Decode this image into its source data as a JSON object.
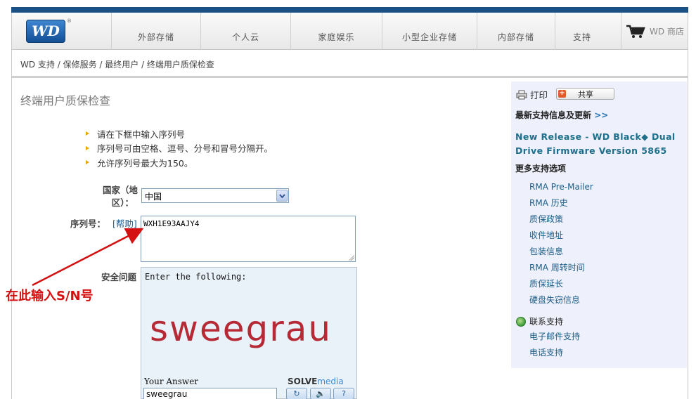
{
  "header": {
    "logo_text": "WD",
    "logo_mark": "®",
    "nav": [
      "外部存储",
      "个人云",
      "家庭娱乐",
      "小型企业存储",
      "内部存储",
      "支持"
    ],
    "shop_label": "WD 商店",
    "shop_icon": "cart-icon"
  },
  "breadcrumb": "WD 支持 / 保修服务 / 最终用户 / 终端用户质保检查",
  "main": {
    "title": "终端用户质保检查",
    "bullets": [
      "请在下框中输入序列号",
      "序列号可由空格、逗号、分号和冒号分隔开。",
      "允许序列号最大为150。"
    ],
    "country_label_line1": "国家（地",
    "country_label_line2": "区）：",
    "country_value": "中国",
    "serial_label": "序列号：",
    "help_link": "[帮助]",
    "serial_value": "WXH1E93AAJY4",
    "security_label": "安全问题",
    "captcha_prompt": "Enter the following:",
    "captcha_word": "sweegrau",
    "answer_label": "Your Answer",
    "answer_value": "sweegrau",
    "solve_brand_a": "SOLVE",
    "solve_brand_b": "media",
    "btn_refresh": "↻",
    "btn_audio": "🔈",
    "btn_help": "?"
  },
  "annotation": "在此输入S/N号",
  "sidebar": {
    "print": "打印",
    "share": "共享",
    "latest_heading": "最新支持信息及更新",
    "latest_more": ">>",
    "release": "New Release - WD Black◆ Dual Drive Firmware Version 5865",
    "more_heading": "更多支持选项",
    "links": [
      "RMA Pre-Mailer",
      "RMA 历史",
      "质保政策",
      "收件地址",
      "包装信息",
      "RMA 周转时间",
      "质保延长",
      "硬盘失窃信息"
    ],
    "contact_heading": "联系支持",
    "contact_links": [
      "电子邮件支持",
      "电话支持"
    ]
  },
  "colors": {
    "brand_blue": "#1c4f82",
    "captcha_red": "#b52a35",
    "annotation_red": "#d41010",
    "sidebar_bg": "#eef0fb"
  }
}
